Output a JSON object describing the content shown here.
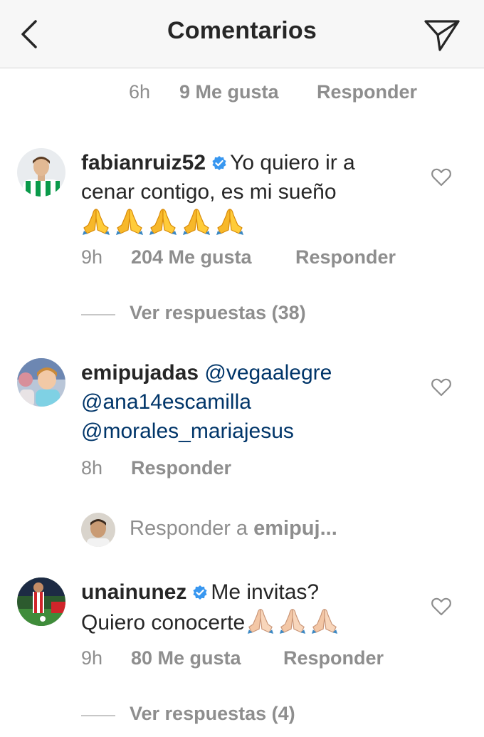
{
  "header": {
    "title": "Comentarios",
    "back_icon": "chevron-left-icon",
    "send_icon": "paper-plane-icon"
  },
  "top_meta": {
    "time": "6h",
    "likes": "9 Me gusta",
    "reply": "Responder"
  },
  "comments": [
    {
      "username": "fabianruiz52",
      "verified": true,
      "text_line1": "Yo quiero ir a",
      "text_line2": "cenar contigo, es mi sueño",
      "emoji": "folded-hands x5",
      "time": "9h",
      "likes": "204 Me gusta",
      "reply": "Responder",
      "view_replies": "Ver respuestas (38)"
    },
    {
      "username": "emipujadas",
      "verified": false,
      "mention1": "@vegaalegre",
      "mention2": "@ana14escamilla",
      "mention3": "@morales_mariajesus",
      "time": "8h",
      "reply": "Responder"
    },
    {
      "username": "unainunez",
      "verified": true,
      "text_line1": "Me invitas?",
      "text_line2": "Quiero conocerte",
      "emoji": "folded-hands-light x3",
      "time": "9h",
      "likes": "80 Me gusta",
      "reply": "Responder",
      "view_replies": "Ver respuestas (4)"
    }
  ],
  "reply_box": {
    "prefix": "Responder a ",
    "target": "emipuj..."
  },
  "colors": {
    "text": "#262626",
    "muted": "#8e8e8e",
    "mention": "#003569",
    "verified": "#3897f0",
    "header_bg": "#f7f7f7"
  }
}
